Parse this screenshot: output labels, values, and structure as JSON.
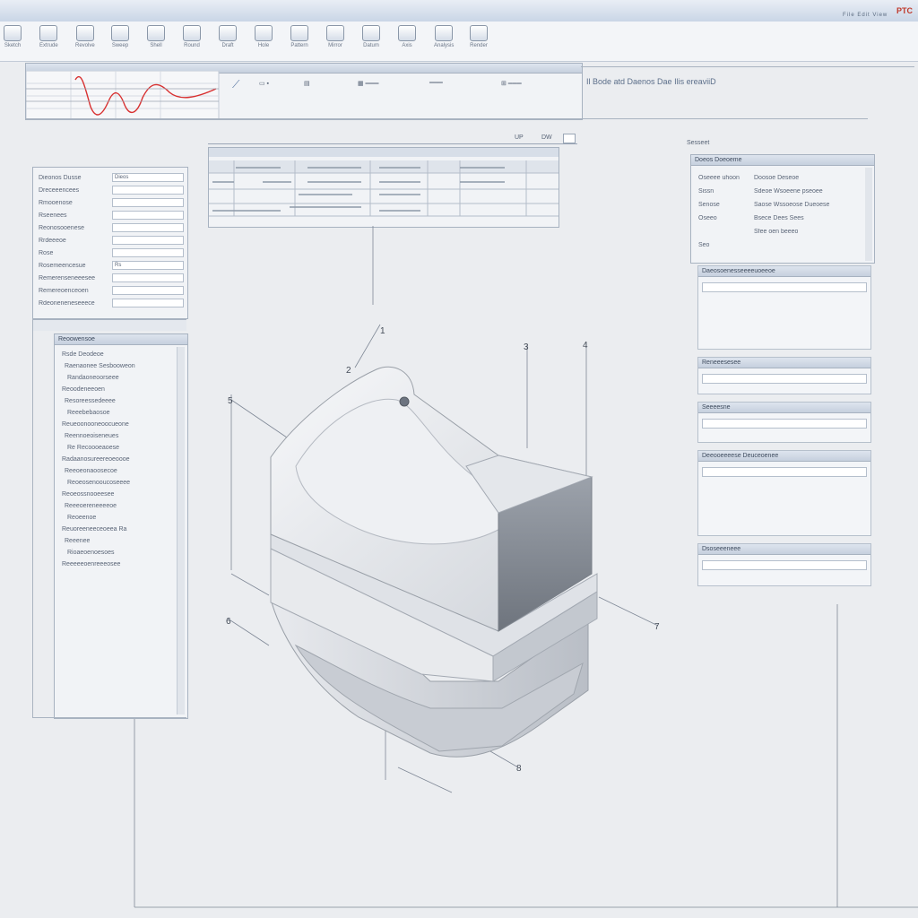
{
  "window": {
    "title": "",
    "brand": "PTC",
    "menu": "File  Edit  View"
  },
  "ribbon": {
    "buttons": [
      {
        "label": "Sketch"
      },
      {
        "label": "Extrude"
      },
      {
        "label": "Revolve"
      },
      {
        "label": "Sweep"
      },
      {
        "label": "Shell"
      },
      {
        "label": "Round"
      },
      {
        "label": "Draft"
      },
      {
        "label": "Hole"
      },
      {
        "label": "Pattern"
      },
      {
        "label": "Mirror"
      },
      {
        "label": "Datum"
      },
      {
        "label": "Axis"
      },
      {
        "label": "Analysis"
      },
      {
        "label": "Render"
      }
    ]
  },
  "graph": {
    "title": "",
    "header_text": "Il Bode atd Daenos Dae Ilis ereaviiD"
  },
  "table_top": {
    "tab_labels": [
      "UP",
      "DW"
    ]
  },
  "left_panel": {
    "rows": [
      {
        "label": "Dieonos Dusse",
        "value": "Dieos"
      },
      {
        "label": "Dreceeencees",
        "value": ""
      },
      {
        "label": "Rmooenose",
        "value": ""
      },
      {
        "label": "Rseenees",
        "value": ""
      },
      {
        "label": "Reonosooenese",
        "value": ""
      },
      {
        "label": "Rrdeeeoe",
        "value": ""
      },
      {
        "label": "Rose",
        "value": ""
      },
      {
        "label": "Rosemeencesue",
        "value": "Rs"
      },
      {
        "label": "Remerenseneeesee",
        "value": ""
      },
      {
        "label": "Remereoenceoen",
        "value": ""
      },
      {
        "label": "Rdeoneneneseeece",
        "value": ""
      }
    ]
  },
  "tree_panel": {
    "header": "Reoowensoe",
    "items": [
      "Rsde Deodeoe",
      "Raenaonee Sesbooweon",
      "Randaoneoorseee",
      "Reoodeneeoen",
      "Resoreessedeeee",
      "Reeebebaosoe",
      "Reueoonooneoocueone",
      "Reennoeoiseneues",
      "Re Recoooeaoese",
      "Radaanosureereoeoooe",
      "Reeoeonaoosecoe",
      "Reoeosenooucoseeee",
      "Reoeossnooeesee",
      "Reeeoereneeeeoe",
      "Reoeenoe",
      "Reuoreeneeceoeea Ra",
      "Reeenee",
      "Rioaeoenoesoes",
      "Reeeeeoenreeeosee"
    ]
  },
  "right_panel": {
    "top_label": "Sesseet",
    "header": "Doeos Doeoeme",
    "rows": [
      {
        "k": "Oseeee uhoon",
        "v": "Doosoe Deseoe"
      },
      {
        "k": "Sissn",
        "v": "Sdeoe Wsoeene pseoee"
      },
      {
        "k": "Senose",
        "v": "Saose Wssoeose Dueoese"
      },
      {
        "k": "Oseeo",
        "v": "Bsece Dees Sees"
      },
      {
        "k": "",
        "v": "Sfee oen beeeo"
      },
      {
        "k": "Seo",
        "v": ""
      }
    ],
    "sections": [
      "Daeosoenesseeeeuoeeoe",
      "Reneeesesee",
      "Seeeesne",
      "Deeooeeeese Deuceoenee",
      "Dsoseeeneee"
    ]
  },
  "callouts": [
    "1",
    "2",
    "3",
    "4",
    "5",
    "6",
    "7",
    "8"
  ]
}
